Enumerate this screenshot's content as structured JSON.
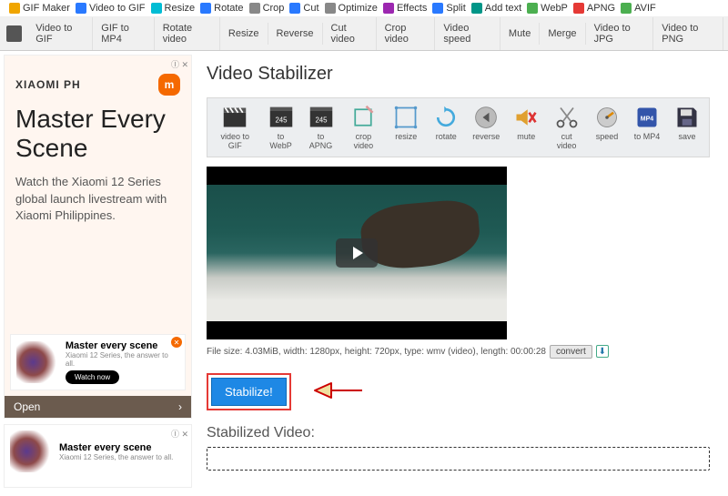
{
  "topnav": {
    "items": [
      {
        "label": "GIF Maker"
      },
      {
        "label": "Video to GIF"
      },
      {
        "label": "Resize"
      },
      {
        "label": "Rotate"
      },
      {
        "label": "Crop"
      },
      {
        "label": "Cut"
      },
      {
        "label": "Optimize"
      },
      {
        "label": "Effects"
      },
      {
        "label": "Split"
      },
      {
        "label": "Add text"
      },
      {
        "label": "WebP"
      },
      {
        "label": "APNG"
      },
      {
        "label": "AVIF"
      }
    ]
  },
  "subnav": {
    "items": [
      {
        "label": "Video to GIF"
      },
      {
        "label": "GIF to MP4"
      },
      {
        "label": "Rotate video"
      },
      {
        "label": "Resize"
      },
      {
        "label": "Reverse"
      },
      {
        "label": "Cut video"
      },
      {
        "label": "Crop video"
      },
      {
        "label": "Video speed"
      },
      {
        "label": "Mute"
      },
      {
        "label": "Merge"
      },
      {
        "label": "Video to JPG"
      },
      {
        "label": "Video to PNG"
      }
    ]
  },
  "page": {
    "title": "Video Stabilizer"
  },
  "tools": {
    "items": [
      {
        "label": "video to GIF"
      },
      {
        "label": "to WebP"
      },
      {
        "label": "to APNG"
      },
      {
        "label": "crop video"
      },
      {
        "label": "resize"
      },
      {
        "label": "rotate"
      },
      {
        "label": "reverse"
      },
      {
        "label": "mute"
      },
      {
        "label": "cut video"
      },
      {
        "label": "speed"
      },
      {
        "label": "to MP4"
      },
      {
        "label": "save"
      }
    ]
  },
  "meta": {
    "text": "File size: 4.03MiB, width: 1280px, height: 720px, type: wmv (video), length: 00:00:28",
    "convert": "convert"
  },
  "action": {
    "stabilize": "Stabilize!"
  },
  "result": {
    "title": "Stabilized Video:"
  },
  "ad1": {
    "brand": "XIAOMI PH",
    "logo": "m",
    "headline": "Master Every Scene",
    "copy": "Watch the Xiaomi 12 Series global launch livestream with Xiaomi Philippines.",
    "sub_title": "Master every scene",
    "sub_text": "Xiaomi 12 Series, the answer to all.",
    "sub_btn": "Watch now",
    "open": "Open",
    "ad_tag": "Ⓘ ✕"
  },
  "ad2": {
    "title": "Master every scene",
    "text": "Xiaomi 12 Series, the answer to all.",
    "ad_tag": "Ⓘ ✕"
  }
}
